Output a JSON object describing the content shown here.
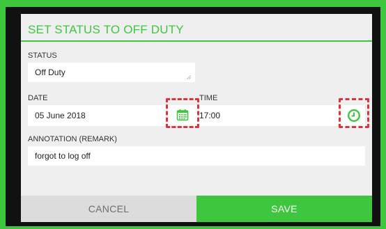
{
  "dialog": {
    "title": "SET STATUS TO OFF DUTY",
    "status_label": "STATUS",
    "status_value": "Off Duty",
    "date_label": "DATE",
    "date_value": "05 June 2018",
    "time_label": "TIME",
    "time_value": "17:00",
    "annotation_label": "ANNOTATION (REMARK)",
    "annotation_value": "forgot to log off",
    "cancel_label": "CANCEL",
    "save_label": "SAVE"
  },
  "icons": {
    "date_picker": "calendar-icon",
    "time_picker": "clock-icon"
  },
  "colors": {
    "accent": "#3fc63f",
    "highlight": "#e0323c"
  }
}
